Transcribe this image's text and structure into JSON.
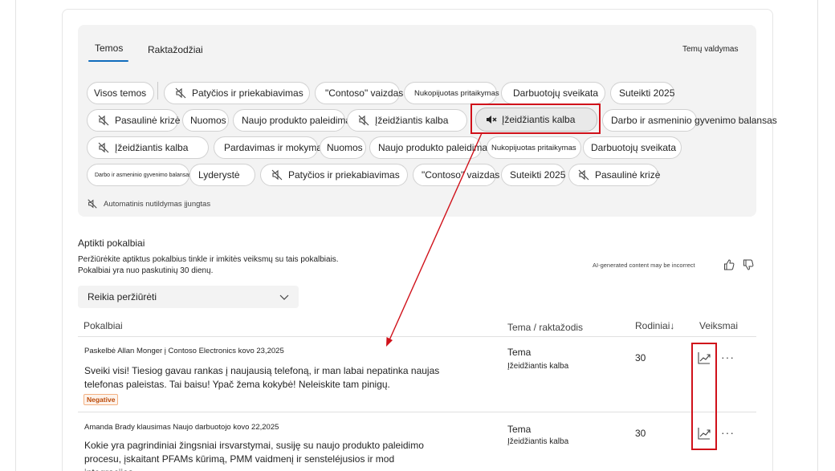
{
  "tabs": [
    {
      "label": "Temos"
    },
    {
      "label": "Raktažodžiai"
    }
  ],
  "manage_label": "Temų valdymas",
  "chips": [
    {
      "label": "Visos temos"
    },
    {
      "label": "Patyčios ir priekabiavimas"
    },
    {
      "label": "\"Contoso\" vaizdas"
    },
    {
      "label": "Nukopijuotas pritaikymas"
    },
    {
      "label": "Darbuotojų sveikata"
    },
    {
      "label": "Suteikti 2025"
    },
    {
      "label": "Pasaulinė krizė"
    },
    {
      "label": "Nuomos"
    },
    {
      "label": "Naujo produkto paleidimas"
    },
    {
      "label": "Įžeidžiantis kalba"
    },
    {
      "label": "Įžeidžiantis kalba"
    },
    {
      "label": "Darbo ir asmeninio gyvenimo balansas"
    },
    {
      "label": "Įžeidžiantis kalba"
    },
    {
      "label": "Pardavimas ir mokymas"
    },
    {
      "label": "Nuomos"
    },
    {
      "label": "Naujo produkto paleidimas"
    },
    {
      "label": "Nukopijuotas pritaikymas"
    },
    {
      "label": "Darbuotojų sveikata"
    },
    {
      "label": "Darbo ir asmeninio gyvenimo balansas"
    },
    {
      "label": "Lyderystė"
    },
    {
      "label": "Patyčios ir priekabiavimas"
    },
    {
      "label": "\"Contoso\" vaizdas"
    },
    {
      "label": "Suteikti 2025"
    },
    {
      "label": "Pasaulinė krizė"
    }
  ],
  "auto_mute_label": "Automatinis nutildymas įjungtas",
  "section": {
    "title": "Aptikti pokalbiai",
    "desc_line1": "Peržiūrėkite aptiktus pokalbius tinkle ir imkitės veiksmų su tais pokalbiais.",
    "desc_line2": "Pokalbiai yra nuo paskutinių 30 dienų.",
    "ai_note": "AI-generated content may be incorrect"
  },
  "filter": {
    "value": "Reikia peržiūrėti"
  },
  "columns": {
    "conversations": "Pokalbiai",
    "topic": "Tema / raktažodis",
    "views": "Rodiniai↓",
    "actions": "Veiksmai"
  },
  "rows": [
    {
      "meta": "Paskelbė Allan Monger į Contoso Electronics kovo 23,2025",
      "line1": "Sveiki visi! Tiesiog gavau rankas į naujausią telefoną, ir man labai nepatinka naujas",
      "line2": "telefonas paleistas. Tai baisu! Ypač žema kokybė! Neleiskite tam pinigų.",
      "badge": "Negative",
      "topic_label": "Tema",
      "topic_value": "Įžeidžiantis kalba",
      "views": "30"
    },
    {
      "meta": "Amanda Brady klausimas Naujo darbuotojo kovo 22,2025",
      "line1": "Kokie yra pagrindiniai žingsniai irsvarstymai, susiję su naujo produkto paleidimo",
      "line2": "procesu, įskaitant PFAMs kūrimą, PMM vaidmenį ir sensteléjusios ir mod integracijos...",
      "topic_label": "Tema",
      "topic_value": "Įžeidžiantis kalba",
      "views": "30"
    }
  ],
  "colors": {
    "accent": "#0f6cbd",
    "highlight": "#d0111a",
    "badge_text": "#bc4b09"
  }
}
